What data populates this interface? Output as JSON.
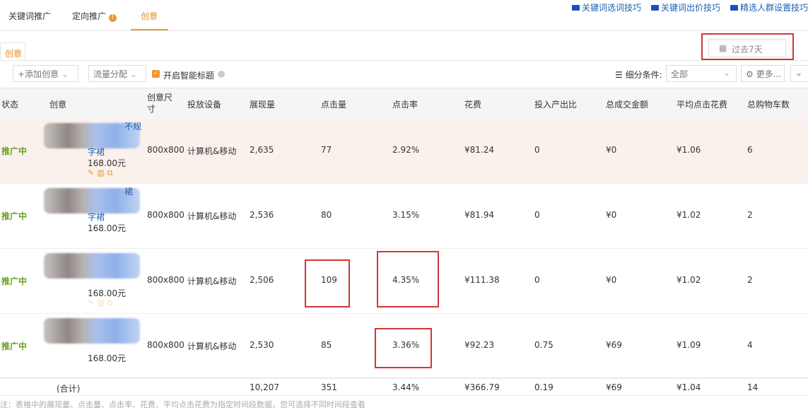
{
  "tabs": [
    {
      "label": "关键词推广"
    },
    {
      "label": "定向推广"
    },
    {
      "label": "创意"
    }
  ],
  "help_links": [
    "关键词选词技巧",
    "关键词出价技巧",
    "精选人群设置技巧"
  ],
  "subtab": "创意",
  "date_range": "过去7天",
  "toolbar": {
    "add_creative": "+添加创意",
    "traffic": "流量分配",
    "smart_title": "开启智能标题",
    "segment_label": "细分条件:",
    "segment_value": "全部",
    "more": "更多..."
  },
  "columns": [
    "状态",
    "创意",
    "创意尺寸",
    "投放设备",
    "展现量",
    "点击量",
    "点击率",
    "花费",
    "投入产出比",
    "总成交金额",
    "平均点击花费",
    "总购物车数"
  ],
  "rows": [
    {
      "status": "推广中",
      "title_tail": "字裙",
      "title_top": "不规",
      "price": "168.00元",
      "size": "800x800",
      "device": "计算机&移动",
      "impressions": "2,635",
      "clicks": "77",
      "ctr": "2.92%",
      "cost": "¥81.24",
      "roi": "0",
      "gmv": "¥0",
      "cpc": "¥1.06",
      "cart": "6"
    },
    {
      "status": "推广中",
      "title_tail": "字裙",
      "title_top": "裙",
      "price": "168.00元",
      "size": "800x800",
      "device": "计算机&移动",
      "impressions": "2,536",
      "clicks": "80",
      "ctr": "3.15%",
      "cost": "¥81.94",
      "roi": "0",
      "gmv": "¥0",
      "cpc": "¥1.02",
      "cart": "2"
    },
    {
      "status": "推广中",
      "title_tail": "",
      "title_top": "",
      "price": "168.00元",
      "size": "800x800",
      "device": "计算机&移动",
      "impressions": "2,506",
      "clicks": "109",
      "ctr": "4.35%",
      "cost": "¥111.38",
      "roi": "0",
      "gmv": "¥0",
      "cpc": "¥1.02",
      "cart": "2"
    },
    {
      "status": "推广中",
      "title_tail": "",
      "title_top": "",
      "price": "168.00元",
      "size": "800x800",
      "device": "计算机&移动",
      "impressions": "2,530",
      "clicks": "85",
      "ctr": "3.36%",
      "cost": "¥92.23",
      "roi": "0.75",
      "gmv": "¥69",
      "cpc": "¥1.09",
      "cart": "4"
    }
  ],
  "total": {
    "label": "(合计)",
    "impressions": "10,207",
    "clicks": "351",
    "ctr": "3.44%",
    "cost": "¥366.79",
    "roi": "0.19",
    "gmv": "¥69",
    "cpc": "¥1.04",
    "cart": "14"
  },
  "note": "注：表格中的展现量、点击量、点击率、花费、平均点击花费为指定时间段数据，您可选择不同时间段查看"
}
